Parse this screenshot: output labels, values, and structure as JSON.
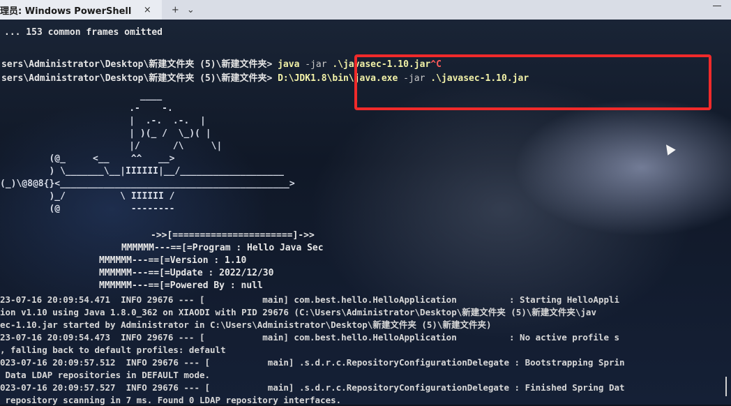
{
  "window": {
    "tab_title": "理员: Windows PowerShell",
    "close_glyph": "×",
    "new_tab_glyph": "+",
    "dropdown_glyph": "⌄"
  },
  "terminal": {
    "frames_omitted": "... 153 common frames omitted",
    "prompt1": "sers\\Administrator\\Desktop\\新建文件夹 (5)\\新建文件夹> ",
    "cmd1_exe": "java",
    "cmd1_arg": " -jar ",
    "cmd1_file": ".\\javasec-1.10.jar",
    "cmd1_ctrl": "^C",
    "prompt2": "sers\\Administrator\\Desktop\\新建文件夹 (5)\\新建文件夹> ",
    "cmd2_exe": "D:\\JDK1.8\\bin\\java.exe",
    "cmd2_arg": " -jar ",
    "cmd2_file": ".\\javasec-1.10.jar",
    "art": [
      "                  ____",
      "                .-    -.",
      "                |  .-.  .-.  |",
      "                | )(_ /  \\_)( |",
      "                |/      /\\     \\|",
      "         (@_     <__    ^^   __>",
      "         ) \\_______\\__|IIIIII|__/___________________",
      "(_)\\@8@8{}<__________________________________________>",
      "         )_/          \\ IIIIII /",
      "         (@             --------"
    ],
    "banner": [
      "->>[======================]->>",
      "MMMMMM---==[=Program : Hello Java Sec",
      "MMMMMM---==[=Version : 1.10",
      "MMMMMM---==[=Update : 2022/12/30",
      "MMMMMM---==[=Powered By : null"
    ],
    "logs": [
      "23-07-16 20:09:54.471  INFO 29676 --- [           main] com.best.hello.HelloApplication          : Starting HelloAppli",
      "ion v1.10 using Java 1.8.0_362 on XIAODI with PID 29676 (C:\\Users\\Administrator\\Desktop\\新建文件夹 (5)\\新建文件夹\\jav",
      "ec-1.10.jar started by Administrator in C:\\Users\\Administrator\\Desktop\\新建文件夹 (5)\\新建文件夹)",
      "23-07-16 20:09:54.473  INFO 29676 --- [           main] com.best.hello.HelloApplication          : No active profile s",
      ", falling back to default profiles: default",
      "023-07-16 20:09:57.512  INFO 29676 --- [           main] .s.d.r.c.RepositoryConfigurationDelegate : Bootstrapping Sprin",
      " Data LDAP repositories in DEFAULT mode.",
      "023-07-16 20:09:57.527  INFO 29676 --- [           main] .s.d.r.c.RepositoryConfigurationDelegate : Finished Spring Dat",
      " repository scanning in 7 ms. Found 0 LDAP repository interfaces."
    ]
  },
  "colors": {
    "highlight_border": "#f02a2a",
    "command_yellow": "#f2f2a8"
  }
}
